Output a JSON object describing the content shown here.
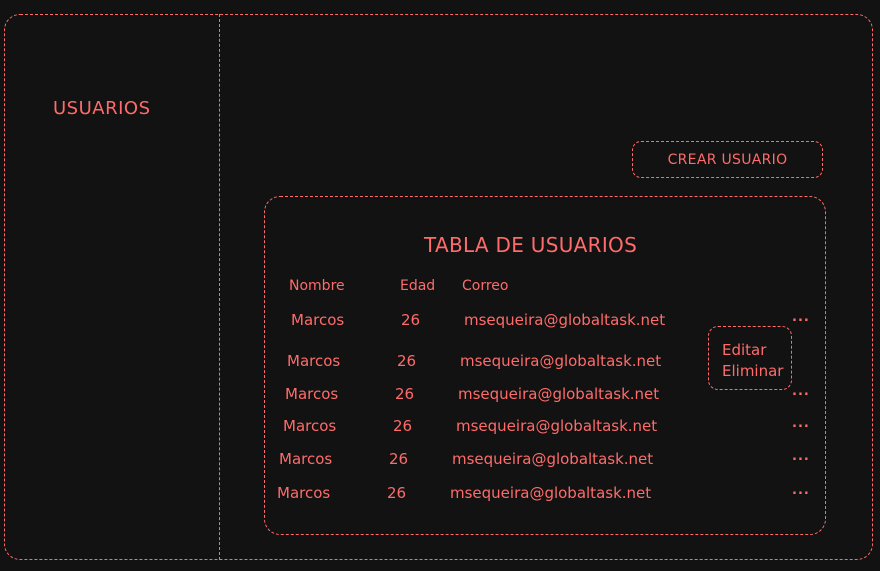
{
  "sidebar": {
    "title": "USUARIOS"
  },
  "toolbar": {
    "create_label": "CREAR USUARIO"
  },
  "table": {
    "title": "TABLA DE USUARIOS",
    "headers": {
      "nombre": "Nombre",
      "edad": "Edad",
      "correo": "Correo"
    },
    "rows": [
      {
        "nombre": "Marcos",
        "edad": "26",
        "correo": "msequeira@globaltask.net",
        "actions": "..."
      },
      {
        "nombre": "Marcos",
        "edad": "26",
        "correo": "msequeira@globaltask.net",
        "actions": ""
      },
      {
        "nombre": "Marcos",
        "edad": "26",
        "correo": "msequeira@globaltask.net",
        "actions": "..."
      },
      {
        "nombre": "Marcos",
        "edad": "26",
        "correo": "msequeira@globaltask.net",
        "actions": "..."
      },
      {
        "nombre": "Marcos",
        "edad": "26",
        "correo": "msequeira@globaltask.net",
        "actions": "..."
      },
      {
        "nombre": "Marcos",
        "edad": "26",
        "correo": "msequeira@globaltask.net",
        "actions": "..."
      }
    ]
  },
  "action_menu": {
    "edit_label": "Editar",
    "delete_label": "Eliminar"
  }
}
